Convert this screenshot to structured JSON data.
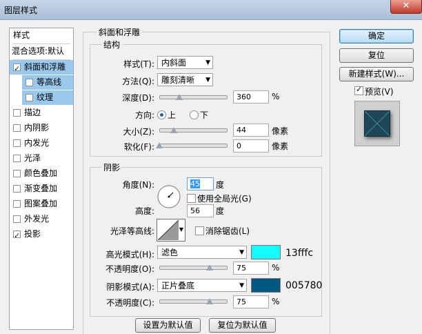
{
  "window": {
    "title": "图层样式",
    "close": "✕"
  },
  "left": {
    "header": "样式",
    "blend": "混合选项:默认",
    "items": [
      {
        "label": "斜面和浮雕",
        "checked": true,
        "selected": true,
        "sub": false
      },
      {
        "label": "等高线",
        "checked": false,
        "selected": true,
        "sub": true
      },
      {
        "label": "纹理",
        "checked": false,
        "selected": true,
        "sub": true
      },
      {
        "label": "描边",
        "checked": false,
        "selected": false,
        "sub": false
      },
      {
        "label": "内阴影",
        "checked": false,
        "selected": false,
        "sub": false
      },
      {
        "label": "内发光",
        "checked": false,
        "selected": false,
        "sub": false
      },
      {
        "label": "光泽",
        "checked": false,
        "selected": false,
        "sub": false
      },
      {
        "label": "颜色叠加",
        "checked": false,
        "selected": false,
        "sub": false
      },
      {
        "label": "渐变叠加",
        "checked": false,
        "selected": false,
        "sub": false
      },
      {
        "label": "图案叠加",
        "checked": false,
        "selected": false,
        "sub": false
      },
      {
        "label": "外发光",
        "checked": false,
        "selected": false,
        "sub": false
      },
      {
        "label": "投影",
        "checked": true,
        "selected": false,
        "sub": false
      }
    ]
  },
  "bevel": {
    "title": "斜面和浮雕",
    "structure": {
      "title": "结构",
      "style_label": "样式(T):",
      "style_value": "内斜面",
      "method_label": "方法(Q):",
      "method_value": "雕刻清晰",
      "depth_label": "深度(D):",
      "depth_value": "360",
      "depth_unit": "%",
      "depth_pos": 0.3,
      "direction_label": "方向:",
      "dir_up": "上",
      "dir_down": "下",
      "size_label": "大小(Z):",
      "size_value": "44",
      "size_unit": "像素",
      "size_pos": 0.22,
      "soften_label": "软化(F):",
      "soften_value": "0",
      "soften_unit": "像素",
      "soften_pos": 0.0
    },
    "shading": {
      "title": "阴影",
      "angle_label": "角度(N):",
      "angle_value": "45",
      "angle_unit": "度",
      "global_label": "使用全局光(G)",
      "altitude_label": "高度:",
      "altitude_value": "56",
      "altitude_unit": "度",
      "gloss_label": "光泽等高线:",
      "antialias_label": "消除锯齿(L)",
      "highlight_label": "高光模式(H):",
      "highlight_mode": "滤色",
      "highlight_color": "#13ffff",
      "highlight_hex": "13fffc",
      "opacity1_label": "不透明度(O):",
      "opacity1_value": "75",
      "opacity1_unit": "%",
      "opacity1_pos": 0.75,
      "shadow_label": "阴影模式(A):",
      "shadow_mode": "正片叠底",
      "shadow_color": "#005780",
      "shadow_hex": "005780",
      "opacity2_label": "不透明度(C):",
      "opacity2_value": "75",
      "opacity2_unit": "%",
      "opacity2_pos": 0.75
    },
    "set_default": "设置为默认值",
    "reset_default": "复位为默认值"
  },
  "right": {
    "ok": "确定",
    "reset": "复位",
    "new_style": "新建样式(W)...",
    "preview_label": "预览(V)"
  }
}
